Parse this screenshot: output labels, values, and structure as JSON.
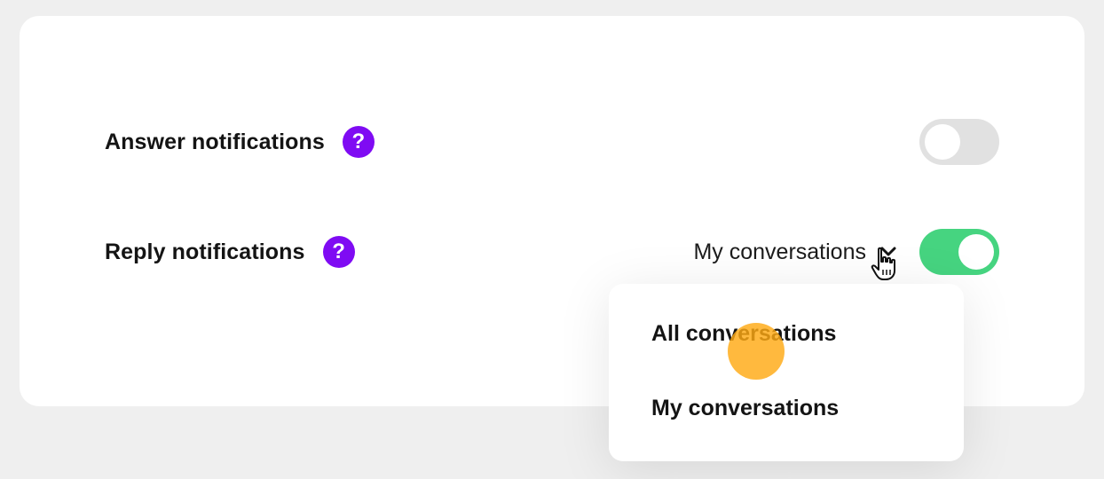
{
  "settings": {
    "answer": {
      "label": "Answer notifications",
      "help_glyph": "?",
      "toggle_on": false
    },
    "reply": {
      "label": "Reply notifications",
      "help_glyph": "?",
      "selected_value": "My conversations",
      "toggle_on": true
    }
  },
  "dropdown": {
    "options": [
      {
        "label": "All conversations"
      },
      {
        "label": "My conversations"
      }
    ]
  },
  "colors": {
    "help_icon": "#7f0bf3",
    "toggle_on": "#46d480",
    "toggle_off": "#e1e1e1",
    "click_highlight": "#ffb21a"
  },
  "icons": {
    "help": "question-mark-icon",
    "select_chevron": "chevron-down-icon",
    "pointer": "hand-pointer-cursor-icon"
  }
}
